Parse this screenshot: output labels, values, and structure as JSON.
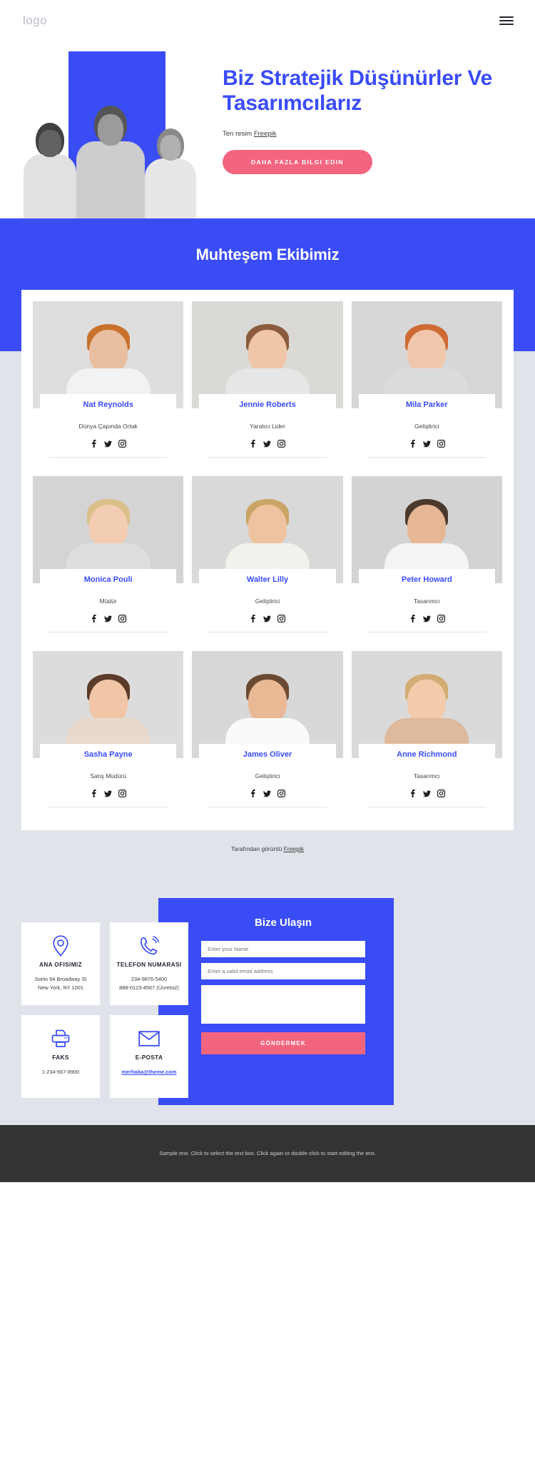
{
  "header": {
    "logo": "logo",
    "menu_icon": "hamburger-menu-icon"
  },
  "hero": {
    "title": "Biz Stratejik Düşünürler Ve Tasarımcılarız",
    "credit_prefix": "Ten resim ",
    "credit_link": "Freepik",
    "cta_label": "DAHA FAZLA BILGI EDIN"
  },
  "team": {
    "heading": "Muhteşem Ekibimiz",
    "credit_prefix": "Tarafından görüntü ",
    "credit_link": "Freepik",
    "social": [
      "facebook-icon",
      "twitter-icon",
      "instagram-icon"
    ],
    "members": [
      {
        "name": "Nat Reynolds",
        "role": "Dünya Çapında Ortak",
        "skin": "#e9bfa1",
        "hair": "#c9712c",
        "shirt": "#f2f2f2",
        "bg": "#dedede"
      },
      {
        "name": "Jennie Roberts",
        "role": "Yaratıcı Lider",
        "skin": "#efc6a8",
        "hair": "#8a5c3b",
        "shirt": "#e6e6e6",
        "bg": "#dbd9d6"
      },
      {
        "name": "Mila Parker",
        "role": "Geliştirici",
        "skin": "#f0c7ab",
        "hair": "#cf6a33",
        "shirt": "#dcdcdc",
        "bg": "#d7d7d7"
      },
      {
        "name": "Monica Pouli",
        "role": "Müdür",
        "skin": "#f2cdb2",
        "hair": "#d9c08a",
        "shirt": "#dedede",
        "bg": "#d4d4d4"
      },
      {
        "name": "Walter Lilly",
        "role": "Geliştirici",
        "skin": "#eec3a0",
        "hair": "#c9a567",
        "shirt": "#f3f1ec",
        "bg": "#d9d9d9"
      },
      {
        "name": "Peter Howard",
        "role": "Tasarımcı",
        "skin": "#e6b795",
        "hair": "#4b3a2c",
        "shirt": "#f4f4f2",
        "bg": "#d3d3d3"
      },
      {
        "name": "Sasha Payne",
        "role": "Satış Müdürü",
        "skin": "#f0c6a6",
        "hair": "#5b3b2a",
        "shirt": "#e8d9cc",
        "bg": "#dcdcdc"
      },
      {
        "name": "James Oliver",
        "role": "Geliştirici",
        "skin": "#e9b894",
        "hair": "#6b4a33",
        "shirt": "#fafafa",
        "bg": "#d8d8d8"
      },
      {
        "name": "Anne Richmond",
        "role": "Tasarımcı",
        "skin": "#f2cbaa",
        "hair": "#d3ab74",
        "shirt": "#dfb99c",
        "bg": "#dadada"
      }
    ]
  },
  "contact": {
    "cards": [
      {
        "icon": "map-pin-icon",
        "title": "ANA OFISIMIZ",
        "lines": [
          "SoHo 94 Broadway St",
          "New York, NY 1001"
        ],
        "link": ""
      },
      {
        "icon": "phone-icon",
        "title": "TELEFON NUMARASI",
        "lines": [
          "234-9876-5400",
          "888-0123-4567 (Ücretsiz)"
        ],
        "link": ""
      },
      {
        "icon": "fax-printer-icon",
        "title": "FAKS",
        "lines": [
          "1-234-567-8900"
        ],
        "link": ""
      },
      {
        "icon": "envelope-icon",
        "title": "E-POSTA",
        "lines": [],
        "link": "merhaba@theme.com"
      }
    ],
    "form": {
      "title": "Bize Ulaşın",
      "name_placeholder": "Enter your Name",
      "email_placeholder": "Enter a valid email address",
      "message_placeholder": "",
      "submit_label": "GÖNDERMEK"
    }
  },
  "footer": {
    "text": "Sample text. Click to select the text box. Click again or double click to start editing the text."
  },
  "colors": {
    "brand_blue": "#3a4cf5",
    "accent_pink": "#f3657f",
    "page_grey": "#e0e3ea",
    "footer_dark": "#333333"
  }
}
